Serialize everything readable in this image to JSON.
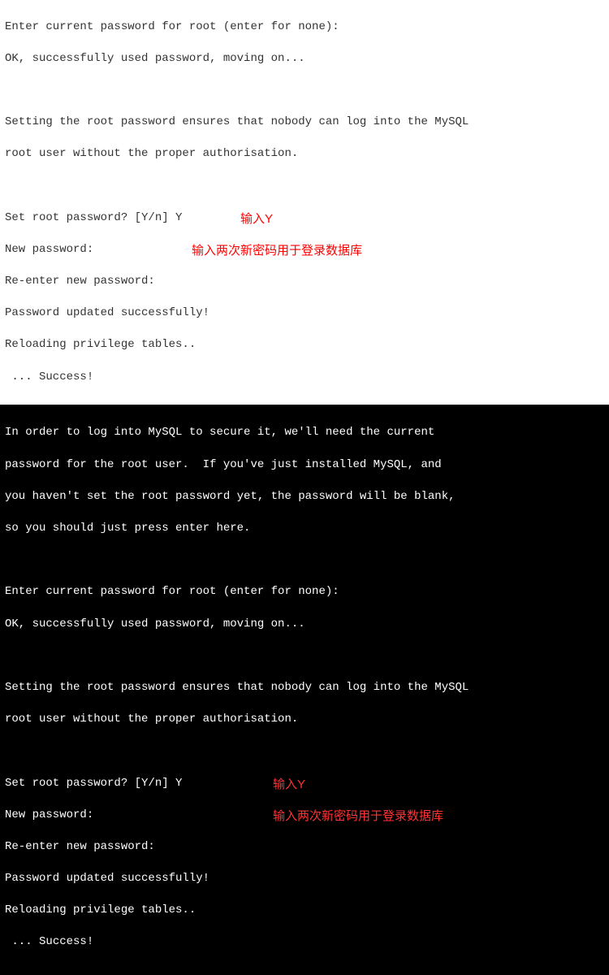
{
  "light": {
    "l1": "Enter current password for root (enter for none):",
    "l2": "OK, successfully used password, moving on...",
    "l3": "",
    "l4": "Setting the root password ensures that nobody can log into the MySQL",
    "l5": "root user without the proper authorisation.",
    "l6": "",
    "l7": "Set root password? [Y/n] Y",
    "l8": "New password:",
    "l9": "Re-enter new password:",
    "l10": "Password updated successfully!",
    "l11": "Reloading privilege tables..",
    "l12": " ... Success!"
  },
  "dark": {
    "d1": "In order to log into MySQL to secure it, we'll need the current",
    "d2": "password for the root user.  If you've just installed MySQL, and",
    "d3": "you haven't set the root password yet, the password will be blank,",
    "d4": "so you should just press enter here.",
    "d5": "",
    "d6": "Enter current password for root (enter for none):",
    "d7": "OK, successfully used password, moving on...",
    "d8": "",
    "d9": "Setting the root password ensures that nobody can log into the MySQL",
    "d10": "root user without the proper authorisation.",
    "d11": "",
    "d12": "Set root password? [Y/n] Y",
    "d13": "New password:",
    "d14": "Re-enter new password:",
    "d15": "Password updated successfully!",
    "d16": "Reloading privilege tables..",
    "d17": " ... Success!"
  },
  "annotations": {
    "input_y": "输入Y",
    "input_password_twice": "输入两次新密码用于登录数据库"
  }
}
